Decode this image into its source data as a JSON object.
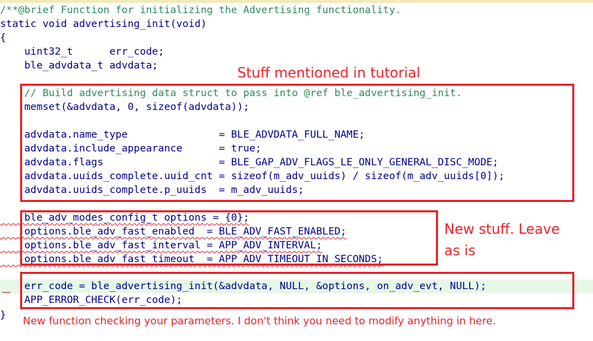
{
  "code_lines": [
    "/**@brief Function for initializing the Advertising functionality.",
    "static void advertising_init(void)",
    "{",
    "    uint32_t      err_code;",
    "    ble_advdata_t advdata;",
    "    // Build advertising data struct to pass into @ref ble_advertising_init.",
    "    memset(&advdata, 0, sizeof(advdata));",
    "    advdata.name_type               = BLE_ADVDATA_FULL_NAME;",
    "    advdata.include_appearance      = true;",
    "    advdata.flags                   = BLE_GAP_ADV_FLAGS_LE_ONLY_GENERAL_DISC_MODE;",
    "    advdata.uuids_complete.uuid_cnt = sizeof(m_adv_uuids) / sizeof(m_adv_uuids[0]);",
    "    advdata.uuids_complete.p_uuids  = m_adv_uuids;",
    "    ble_adv_modes_config_t options = {0};",
    "    options.ble_adv_fast_enabled  = BLE_ADV_FAST_ENABLED;",
    "    options.ble_adv_fast_interval = APP_ADV_INTERVAL;",
    "    options.ble_adv_fast_timeout  = APP_ADV_TIMEOUT_IN_SECONDS;",
    "    err_code = ble_advertising_init(&advdata, NULL, &options, on_adv_evt, NULL);",
    "    APP_ERROR_CHECK(err_code);",
    "}"
  ],
  "annotations": {
    "tutorial": "Stuff mentioned in tutorial",
    "new_stuff_line1": "New stuff. Leave",
    "new_stuff_line2": "as is",
    "new_function": "New function checking your parameters. I don't think you need to modify anything in here."
  },
  "colors": {
    "annotation_red": "#e8242b",
    "code_blue": "#00008b",
    "comment_green": "#2e8b57",
    "highlight_green": "#e6f7e8"
  }
}
